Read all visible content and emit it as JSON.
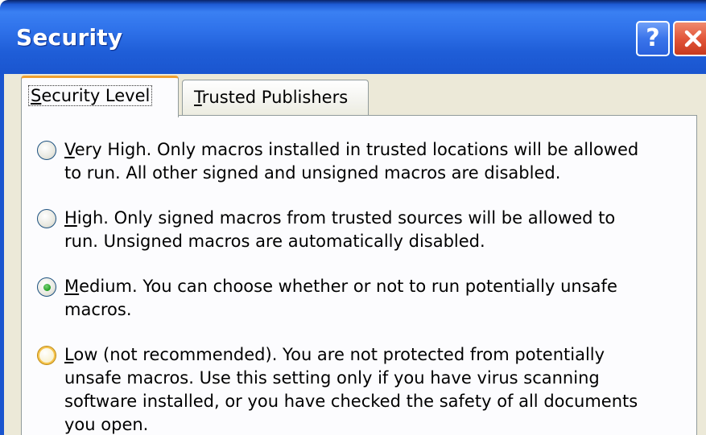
{
  "window": {
    "title": "Security",
    "help_label": "?"
  },
  "tabs": [
    {
      "label": "Security Level",
      "mnemonic": "S",
      "rest": "ecurity Level",
      "selected": true
    },
    {
      "label": "Trusted Publishers",
      "mnemonic": "T",
      "rest": "rusted Publishers",
      "selected": false
    }
  ],
  "options": [
    {
      "mnemonic": "V",
      "line1_rest": "ery High. Only macros installed in trusted locations will be allowed",
      "line2": "to run. All other signed and unsigned macros are disabled.",
      "checked": false
    },
    {
      "mnemonic": "H",
      "line1_rest": "igh. Only signed macros from trusted sources will be allowed to",
      "line2": "run. Unsigned macros are automatically disabled.",
      "checked": false
    },
    {
      "mnemonic": "M",
      "line1_rest": "edium. You can choose whether or not to run potentially unsafe",
      "line2": "macros.",
      "checked": true
    },
    {
      "mnemonic": "L",
      "line1_rest": "ow (not recommended). You are not protected from potentially",
      "line2": "unsafe macros. Use this setting only if you have virus scanning",
      "line3": "software installed, or you have checked the safety of all documents",
      "line4": "you open.",
      "checked": false
    }
  ],
  "colors": {
    "titlebar": "#2f72ea",
    "dialog_bg": "#ece9d8",
    "close_button": "#e2563a",
    "active_tab_accent": "#f0a030",
    "radio_checked": "#21a121"
  }
}
